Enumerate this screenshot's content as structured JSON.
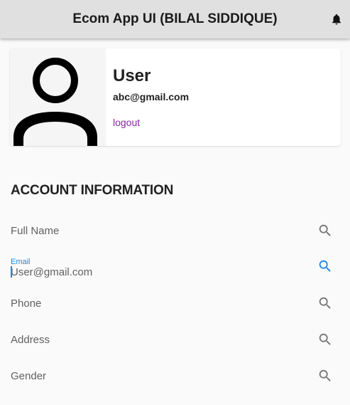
{
  "app_bar": {
    "title": "Ecom App UI (BILAL SIDDIQUE)",
    "notification_icon": "bell-icon"
  },
  "profile": {
    "avatar_icon": "person-icon",
    "name": "User",
    "email": "abc@gmail.com",
    "logout_label": "logout"
  },
  "account": {
    "section_title": "ACCOUNT INFORMATION",
    "fields": [
      {
        "label": "Full Name",
        "icon": "search-icon"
      },
      {
        "label": "Email",
        "value": "User@gmail.com",
        "focused": true,
        "icon": "search-icon"
      },
      {
        "label": "Phone",
        "icon": "search-icon"
      },
      {
        "label": "Address",
        "icon": "search-icon"
      },
      {
        "label": "Gender",
        "icon": "search-icon"
      }
    ]
  },
  "colors": {
    "app_bar_bg": "#e0e0e0",
    "logout": "#8e24aa",
    "focus_accent": "#1e88e5",
    "icon_grey": "#757575"
  }
}
